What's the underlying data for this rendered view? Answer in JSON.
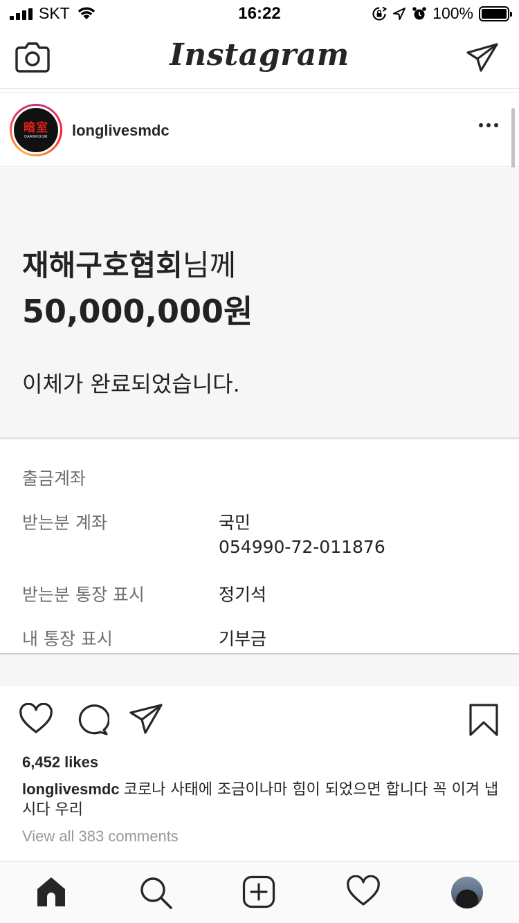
{
  "status_bar": {
    "carrier": "SKT",
    "time": "16:22",
    "battery": "100%"
  },
  "header": {
    "logo": "Instagram",
    "camera_icon": "camera-icon",
    "direct_icon": "paper-plane-icon"
  },
  "post": {
    "username": "longlivesmdc",
    "avatar_text": "暗室",
    "avatar_subtext": "DARKROOM",
    "receipt": {
      "recipient_name": "재해구호협회",
      "recipient_suffix": "님께",
      "amount": "50,000,000원",
      "complete_message": "이체가 완료되었습니다.",
      "rows": [
        {
          "label": "출금계좌",
          "value": ""
        },
        {
          "label": "받는분 계좌",
          "value": "국민"
        },
        {
          "label": "",
          "value": "054990-72-011876"
        },
        {
          "label": "받는분 통장 표시",
          "value": "정기석"
        },
        {
          "label": "내 통장 표시",
          "value": "기부금"
        }
      ]
    },
    "likes": "6,452 likes",
    "caption_user": "longlivesmdc",
    "caption_text": "코로나 사태에 조금이나마 힘이 되었으면 합니다 꼭 이겨 냅시다 우리",
    "view_comments": "View all 383 comments"
  },
  "tab_bar": {
    "items": [
      "home-icon",
      "search-icon",
      "add-post-icon",
      "heart-icon",
      "profile-avatar"
    ]
  },
  "colors": {
    "text": "#262626",
    "secondary_text": "#999999",
    "border": "#dbdbdb"
  }
}
